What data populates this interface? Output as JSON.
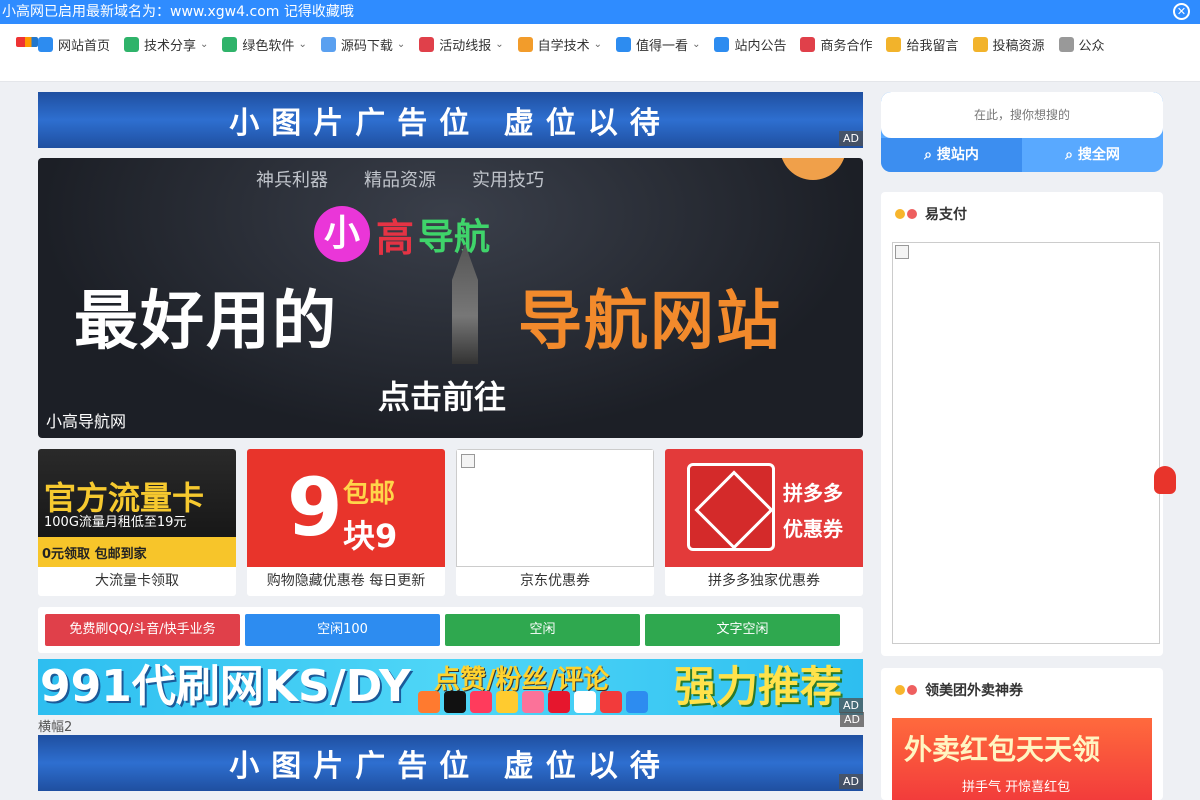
{
  "notice": {
    "text": "小高网已启用最新域名为：www.xgw4.com 记得收藏哦",
    "close": "✕"
  },
  "nav": {
    "items": [
      {
        "label": "网站首页",
        "icon": "home-icon",
        "color": "#2d8cf0",
        "dropdown": false
      },
      {
        "label": "技术分享",
        "icon": "monitor-icon",
        "color": "#2fb36a",
        "dropdown": true
      },
      {
        "label": "绿色软件",
        "icon": "pie-icon",
        "color": "#2fb36a",
        "dropdown": true
      },
      {
        "label": "源码下载",
        "icon": "file-icon",
        "color": "#5aa0f0",
        "dropdown": true
      },
      {
        "label": "活动线报",
        "icon": "gift-icon",
        "color": "#e0404a",
        "dropdown": true
      },
      {
        "label": "自学技术",
        "icon": "grid-icon",
        "color": "#f29c2b",
        "dropdown": true
      },
      {
        "label": "值得一看",
        "icon": "compass-icon",
        "color": "#2d8cf0",
        "dropdown": true
      },
      {
        "label": "站内公告",
        "icon": "speaker-icon",
        "color": "#2d8cf0",
        "dropdown": false
      },
      {
        "label": "商务合作",
        "icon": "heart-icon",
        "color": "#e0404a",
        "dropdown": false
      },
      {
        "label": "给我留言",
        "icon": "message-icon",
        "color": "#f2b32b",
        "dropdown": false
      },
      {
        "label": "投稿资源",
        "icon": "edit-icon",
        "color": "#f2b32b",
        "dropdown": false
      },
      {
        "label": "公众",
        "icon": "wechat-icon",
        "color": "#999999",
        "dropdown": false
      }
    ]
  },
  "ad_top": {
    "text": "小图片广告位 虚位以待",
    "tag": "AD"
  },
  "hero": {
    "tabs": [
      "神兵利器",
      "精品资源",
      "实用技巧"
    ],
    "brand_x": "小",
    "brand_g": "高",
    "brand_d": "导航",
    "headline_left": "最好用的",
    "headline_right": "导航网站",
    "cta": "点击前往",
    "caption": "小高导航网"
  },
  "cards": [
    {
      "caption": "大流量卡领取",
      "big": "官方流量卡",
      "sub": "100G流量月租低至19元",
      "bar": "0元领取 包邮到家"
    },
    {
      "caption": "购物隐藏优惠卷 每日更新",
      "n": "9",
      "s1": "包邮",
      "s2": "块9"
    },
    {
      "caption": "京东优惠券"
    },
    {
      "caption": "拼多多独家优惠券",
      "t1": "拼多多",
      "t2": "优惠券"
    }
  ],
  "buttons": [
    "免费刷QQ/斗音/快手业务",
    "空闲100",
    "空闲",
    "文字空闲"
  ],
  "ad991": {
    "a": "991代刷网KS/DY",
    "b": "点赞/粉丝/评论",
    "c": "强力推荐",
    "tag": "AD"
  },
  "banner2": {
    "alt": "横幅2",
    "tag": "AD"
  },
  "ad_bottom": {
    "text": "小图片广告位 虚位以待",
    "tag": "AD"
  },
  "search": {
    "placeholder": "在此，搜你想搜的",
    "site_btn": "搜站内",
    "web_btn": "搜全网"
  },
  "panel_pay": {
    "title": "易支付"
  },
  "panel_waimai": {
    "title": "领美团外卖神券",
    "t": "外卖红包天天领",
    "s": "拼手气 开惊喜红包"
  }
}
